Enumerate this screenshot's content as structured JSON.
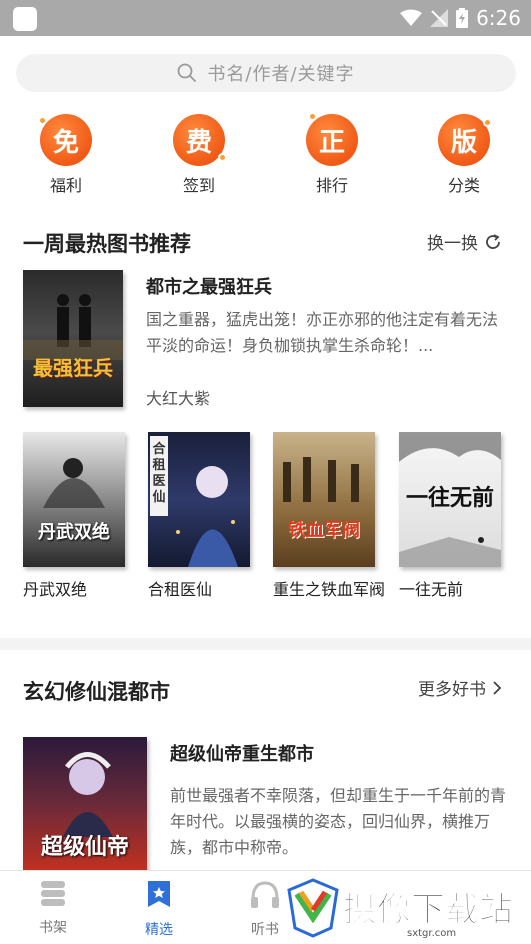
{
  "status_bar": {
    "time": "6:26"
  },
  "search": {
    "placeholder": "书名/作者/关键字"
  },
  "quick_entries": [
    {
      "glyph": "免",
      "label": "福利"
    },
    {
      "glyph": "费",
      "label": "签到"
    },
    {
      "glyph": "正",
      "label": "排行"
    },
    {
      "glyph": "版",
      "label": "分类"
    }
  ],
  "weekly_section": {
    "title": "一周最热图书推荐",
    "action": "换一换",
    "featured": {
      "title": "都市之最强狂兵",
      "description": "国之重器，猛虎出笼！亦正亦邪的他注定有着无法平淡的命运！身负枷锁执掌生杀命轮！...",
      "author": "大红大紫",
      "cover_text": "最强狂兵"
    },
    "books": [
      {
        "title": "丹武双绝",
        "cover_text": "丹武双绝"
      },
      {
        "title": "合租医仙",
        "cover_text": "合租医仙"
      },
      {
        "title": "重生之铁血军阀",
        "cover_text": "铁血军阀"
      },
      {
        "title": "一往无前",
        "cover_text": "一往无前"
      }
    ]
  },
  "fantasy_section": {
    "title": "玄幻修仙混都市",
    "action": "更多好书",
    "featured": {
      "title": "超级仙帝重生都市",
      "description": "前世最强者不幸陨落，但却重生于一千年前的青年时代。以最强横的姿态，回归仙界，横推万族，都市中称帝。",
      "cover_text": "超级仙帝"
    }
  },
  "tab_bar": {
    "tabs": [
      {
        "label": "书架"
      },
      {
        "label": "精选"
      },
      {
        "label": "听书"
      }
    ],
    "active_color": "#2e6fd8"
  },
  "watermark": {
    "text": "摄像下载站",
    "url": "sxtgr.com"
  }
}
